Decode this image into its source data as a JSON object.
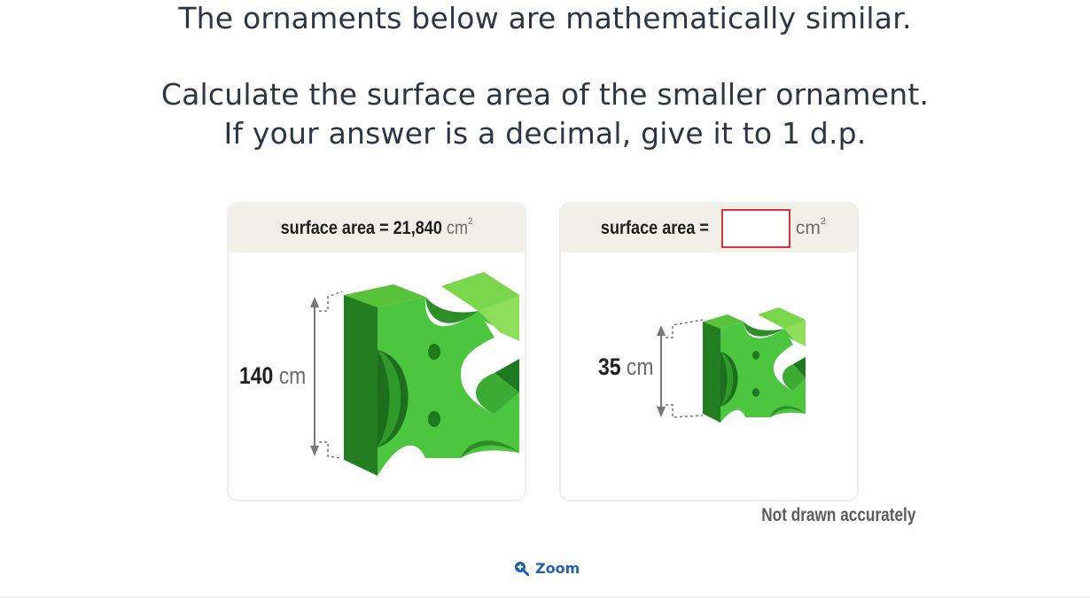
{
  "question": {
    "line1": "The ornaments below are mathematically similar.",
    "line2": "Calculate the surface area of the smaller ornament.",
    "line3": "If your answer is a decimal, give it to 1 d.p."
  },
  "large_card": {
    "header_label": "surface area = 21,840",
    "unit": "cm",
    "unit_power": "2",
    "height_value": "140",
    "height_unit": "cm"
  },
  "small_card": {
    "header_label": "surface area =",
    "answer_value": "",
    "unit": "cm",
    "unit_power": "2",
    "height_value": "35",
    "height_unit": "cm"
  },
  "note": "Not drawn accurately",
  "zoom": {
    "label": "Zoom",
    "icon": "zoom-in-icon"
  },
  "colors": {
    "text": "#2c3644",
    "card_header": "#f2efe9",
    "answer_border": "#e0313a",
    "ornament_light": "#8fde5a",
    "ornament_mid": "#4cc63f",
    "ornament_dark": "#1f7a1f",
    "link": "#2361b5"
  }
}
